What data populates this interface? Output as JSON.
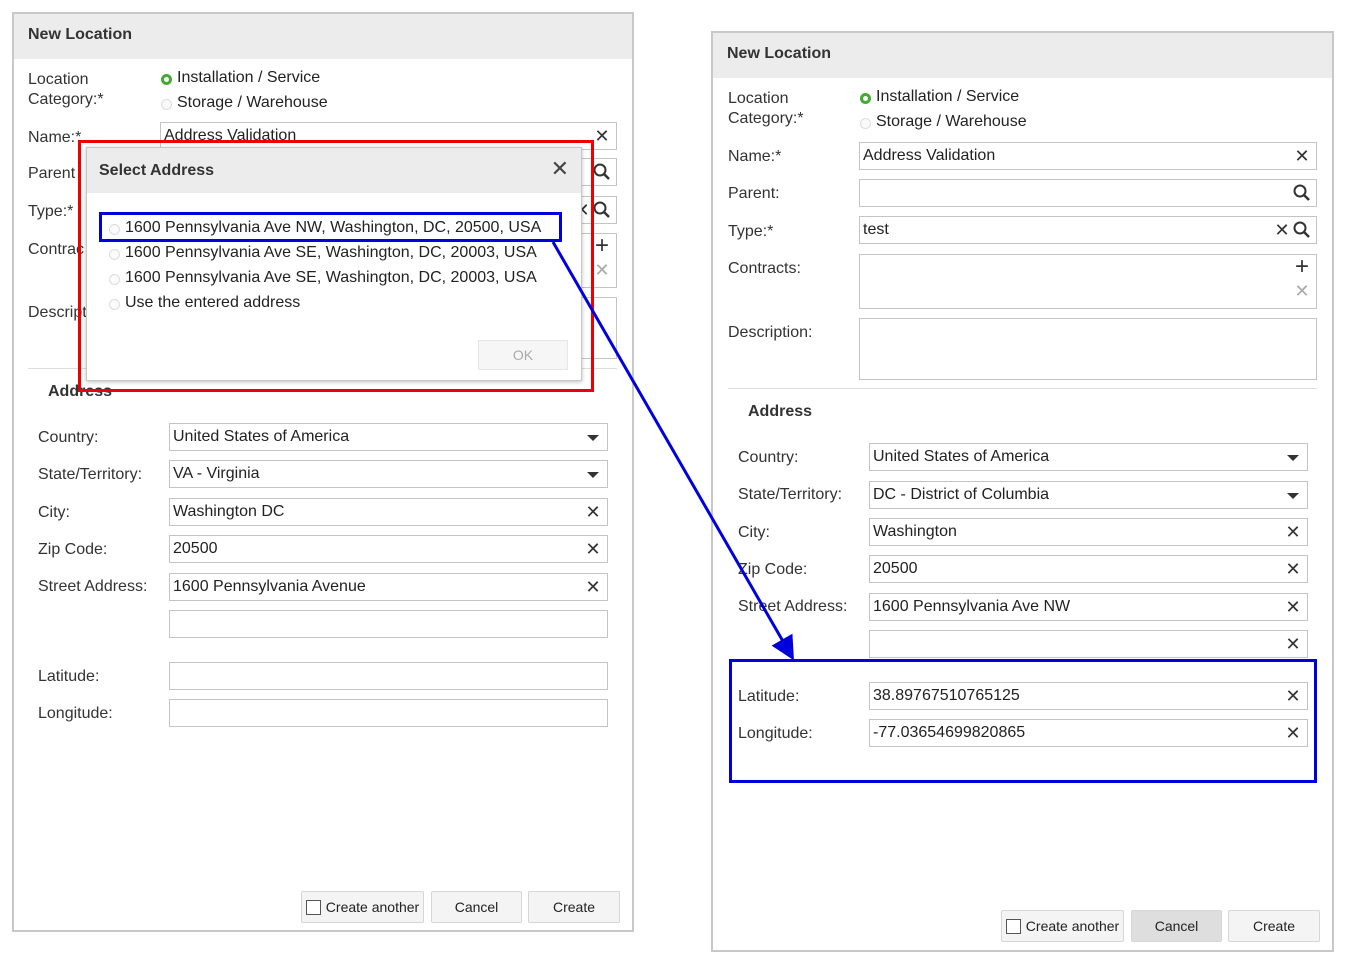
{
  "left_dialog": {
    "title": "New Location",
    "location_category_label": "Location\nCategory:*",
    "location_category_label_line1": "Location",
    "location_category_label_line2": "Category:*",
    "category_options": [
      {
        "label": "Installation / Service",
        "selected": true
      },
      {
        "label": "Storage / Warehouse",
        "selected": false
      }
    ],
    "name_label": "Name:*",
    "name_value": "Address Validation",
    "parent_label_partial": "Parent",
    "type_label": "Type:*",
    "contracts_label_partial": "Contrac",
    "description_label_partial": "Descript",
    "address_section": "Address",
    "country_label": "Country:",
    "country_value": "United States of America",
    "state_label": "State/Territory:",
    "state_value": "VA - Virginia",
    "city_label": "City:",
    "city_value": "Washington DC",
    "zip_label": "Zip Code:",
    "zip_value": "20500",
    "street_label": "Street Address:",
    "street_value": "1600 Pennsylvania Avenue",
    "street2_value": "",
    "latitude_label": "Latitude:",
    "latitude_value": "",
    "longitude_label": "Longitude:",
    "longitude_value": "",
    "create_another_label": "Create another",
    "cancel_label": "Cancel",
    "create_label": "Create"
  },
  "select_address_popup": {
    "title": "Select Address",
    "options": [
      {
        "label": "1600 Pennsylvania Ave NW, Washington, DC, 20500, USA",
        "highlighted": true
      },
      {
        "label": "1600 Pennsylvania Ave SE, Washington, DC, 20003, USA",
        "highlighted": false
      },
      {
        "label": "1600 Pennsylvania Ave SE, Washington, DC, 20003, USA",
        "highlighted": false
      },
      {
        "label": "Use the entered address",
        "highlighted": false
      }
    ],
    "ok_label": "OK"
  },
  "right_dialog": {
    "title": "New Location",
    "location_category_label_line1": "Location",
    "location_category_label_line2": "Category:*",
    "category_options": [
      {
        "label": "Installation / Service",
        "selected": true
      },
      {
        "label": "Storage / Warehouse",
        "selected": false
      }
    ],
    "name_label": "Name:*",
    "name_value": "Address Validation",
    "parent_label": "Parent:",
    "parent_value": "",
    "type_label": "Type:*",
    "type_value": "test",
    "contracts_label": "Contracts:",
    "description_label": "Description:",
    "description_value": "",
    "address_section": "Address",
    "country_label": "Country:",
    "country_value": "United States of America",
    "state_label": "State/Territory:",
    "state_value": "DC - District of Columbia",
    "city_label": "City:",
    "city_value": "Washington",
    "zip_label": "Zip Code:",
    "zip_value": "20500",
    "street_label": "Street Address:",
    "street_value": "1600 Pennsylvania Ave NW",
    "street2_value": "",
    "latitude_label": "Latitude:",
    "latitude_value": "38.89767510765125",
    "longitude_label": "Longitude:",
    "longitude_value": "-77.03654699820865",
    "create_another_label": "Create another",
    "cancel_label": "Cancel",
    "create_label": "Create"
  },
  "colors": {
    "radio_selected": "#44aa33",
    "annotation_red": "#ee0000",
    "annotation_blue": "#0000dd",
    "header_bg": "#ececec"
  }
}
